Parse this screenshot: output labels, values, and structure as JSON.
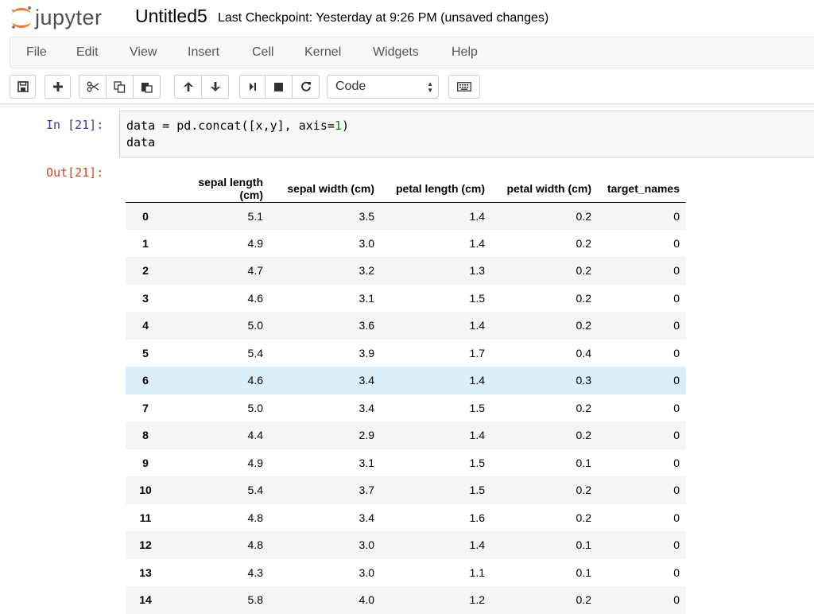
{
  "app": {
    "logo_text": "jupyter",
    "notebook_name": "Untitled5",
    "checkpoint": "Last Checkpoint: Yesterday at 9:26 PM (unsaved changes)"
  },
  "menu": {
    "items": [
      "File",
      "Edit",
      "View",
      "Insert",
      "Cell",
      "Kernel",
      "Widgets",
      "Help"
    ]
  },
  "toolbar": {
    "buttons": [
      {
        "name": "save-icon"
      },
      {
        "name": "plus-icon"
      },
      {
        "name": "scissors-icon"
      },
      {
        "name": "copy-icon"
      },
      {
        "name": "paste-icon"
      },
      {
        "name": "arrow-up-icon"
      },
      {
        "name": "arrow-down-icon"
      },
      {
        "name": "run-icon"
      },
      {
        "name": "stop-icon"
      },
      {
        "name": "restart-icon"
      },
      {
        "name": "keyboard-icon"
      }
    ],
    "cell_type": "Code"
  },
  "cell": {
    "in_prompt": "In [21]:",
    "out_prompt": "Out[21]:",
    "code_line1_a": "data = pd.concat([x,y], axis=",
    "code_line1_num": "1",
    "code_line1_b": ")",
    "code_line2": "data"
  },
  "table": {
    "columns": [
      "",
      "sepal length (cm)",
      "sepal width (cm)",
      "petal length (cm)",
      "petal width (cm)",
      "target_names"
    ],
    "highlighted_row": "6",
    "rows": [
      [
        "0",
        "5.1",
        "3.5",
        "1.4",
        "0.2",
        "0"
      ],
      [
        "1",
        "4.9",
        "3.0",
        "1.4",
        "0.2",
        "0"
      ],
      [
        "2",
        "4.7",
        "3.2",
        "1.3",
        "0.2",
        "0"
      ],
      [
        "3",
        "4.6",
        "3.1",
        "1.5",
        "0.2",
        "0"
      ],
      [
        "4",
        "5.0",
        "3.6",
        "1.4",
        "0.2",
        "0"
      ],
      [
        "5",
        "5.4",
        "3.9",
        "1.7",
        "0.4",
        "0"
      ],
      [
        "6",
        "4.6",
        "3.4",
        "1.4",
        "0.3",
        "0"
      ],
      [
        "7",
        "5.0",
        "3.4",
        "1.5",
        "0.2",
        "0"
      ],
      [
        "8",
        "4.4",
        "2.9",
        "1.4",
        "0.2",
        "0"
      ],
      [
        "9",
        "4.9",
        "3.1",
        "1.5",
        "0.1",
        "0"
      ],
      [
        "10",
        "5.4",
        "3.7",
        "1.5",
        "0.2",
        "0"
      ],
      [
        "11",
        "4.8",
        "3.4",
        "1.6",
        "0.2",
        "0"
      ],
      [
        "12",
        "4.8",
        "3.0",
        "1.4",
        "0.1",
        "0"
      ],
      [
        "13",
        "4.3",
        "3.0",
        "1.1",
        "0.1",
        "0"
      ],
      [
        "14",
        "5.8",
        "4.0",
        "1.2",
        "0.2",
        "0"
      ]
    ]
  },
  "colors": {
    "in_prompt": "#303f9f",
    "out_prompt": "#d84315",
    "row_highlight": "#dbeefb",
    "jupyter_orange": "#f37726"
  }
}
